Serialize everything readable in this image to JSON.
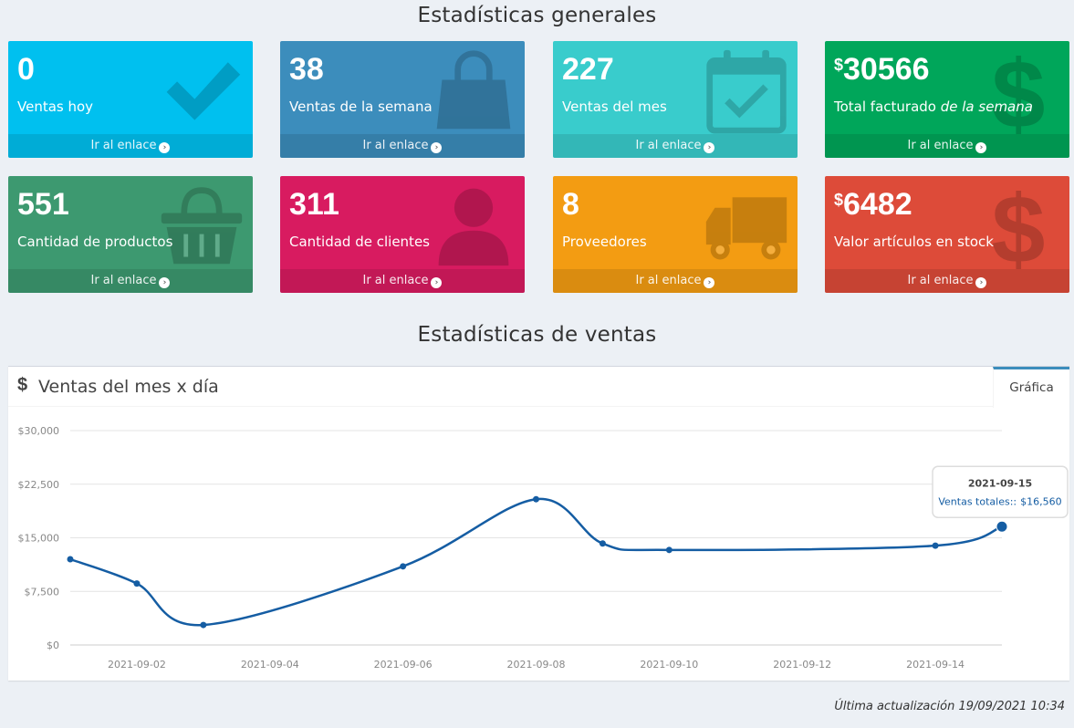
{
  "general_title": "Estadísticas generales",
  "sales_title": "Estadísticas de ventas",
  "boxes": [
    {
      "value": "0",
      "prefix": "",
      "label": "Ventas hoy",
      "link": "Ir al enlace",
      "color": "#00c0ef",
      "icon": "check-icon"
    },
    {
      "value": "38",
      "prefix": "",
      "label": "Ventas de la semana",
      "link": "Ir al enlace",
      "color": "#3c8dbc",
      "icon": "shopping-bag-icon"
    },
    {
      "value": "227",
      "prefix": "",
      "label": "Ventas del mes",
      "link": "Ir al enlace",
      "color": "#39cccc",
      "icon": "calendar-check-icon"
    },
    {
      "value": "30566",
      "prefix": "$",
      "label": "Total facturado",
      "label_em": "de la semana",
      "link": "Ir al enlace",
      "color": "#00a65a",
      "icon": "dollar-icon"
    },
    {
      "value": "551",
      "prefix": "",
      "label": "Cantidad de productos",
      "link": "Ir al enlace",
      "color": "#3d9970",
      "icon": "basket-icon"
    },
    {
      "value": "311",
      "prefix": "",
      "label": "Cantidad de clientes",
      "link": "Ir al enlace",
      "color": "#d81b60",
      "icon": "user-icon"
    },
    {
      "value": "8",
      "prefix": "",
      "label": "Proveedores",
      "link": "Ir al enlace",
      "color": "#f39c12",
      "icon": "truck-icon"
    },
    {
      "value": "6482",
      "prefix": "$",
      "label": "Valor artículos en stock",
      "link": "Ir al enlace",
      "color": "#dd4b39",
      "icon": "dollar-icon"
    }
  ],
  "chart_panel": {
    "icon": "$",
    "title": "Ventas del mes x día",
    "tab_label": "Gráfica"
  },
  "chart_data": {
    "type": "line",
    "x": [
      "2021-09-01",
      "2021-09-02",
      "2021-09-03",
      "2021-09-06",
      "2021-09-08",
      "2021-09-09",
      "2021-09-10",
      "2021-09-14",
      "2021-09-15"
    ],
    "series": [
      {
        "values": [
          12000,
          8600,
          2800,
          11000,
          20400,
          14200,
          13300,
          13900,
          16560
        ]
      }
    ],
    "y_ticks": [
      "$0",
      "$7,500",
      "$15,000",
      "$22,500",
      "$30,000"
    ],
    "x_ticks": [
      "2021-09-02",
      "2021-09-04",
      "2021-09-06",
      "2021-09-08",
      "2021-09-10",
      "2021-09-12",
      "2021-09-14"
    ],
    "ylim": [
      0,
      30000
    ],
    "grid": true,
    "line_color": "#155da3",
    "tooltip": {
      "date": "2021-09-15",
      "label": "Ventas totales::",
      "value": "$16,560"
    }
  },
  "last_update": "Última actualización 19/09/2021 10:34"
}
